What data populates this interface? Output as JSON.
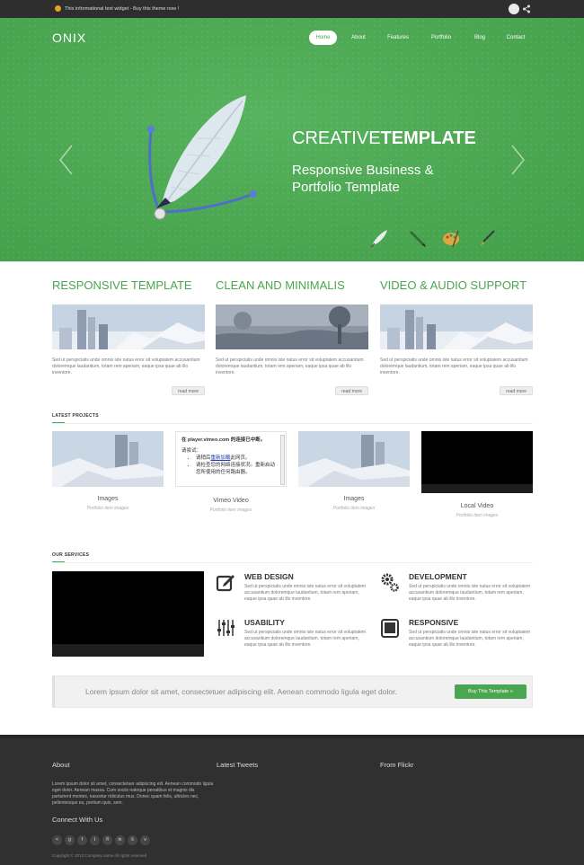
{
  "topbar": {
    "info_text": "This informational text widget - Buy this theme now !"
  },
  "header": {
    "logo": "ONIX",
    "nav": [
      {
        "label": "Home",
        "active": true
      },
      {
        "label": "About",
        "active": false
      },
      {
        "label": "Features",
        "active": false
      },
      {
        "label": "Portfolio",
        "active": false
      },
      {
        "label": "Blog",
        "active": false
      },
      {
        "label": "Contact",
        "active": false
      }
    ]
  },
  "hero": {
    "title_light": "CREATIVE",
    "title_bold": "TEMPLATE",
    "subtitle": "Responsive Business & Portfolio Template",
    "tools": [
      "feather-tool-icon",
      "pen-tool-icon",
      "palette-tool-icon",
      "brush-tool-icon"
    ]
  },
  "features": [
    {
      "title": "RESPONSIVE TEMPLATE",
      "text": "Sed ut perspiciatis unde omnis iste natus error sit voluptatem accusantium doloremque laudantium, totam rem aperiam, eaque ipsa quae ab illo inventore.",
      "button": "read more",
      "image": "city-skyline"
    },
    {
      "title": "CLEAN AND MINIMALIS",
      "text": "Sed ut perspiciatis unde omnis iste natus error sit voluptatem accusantium doloremque laudantium, totam rem aperiam, eaque ipsa quae ab illo inventore.",
      "button": "read more",
      "image": "tree-landscape"
    },
    {
      "title": "VIDEO & AUDIO SUPPORT",
      "text": "Sed ut perspiciatis unde omnis iste natus error sit voluptatem accusantium doloremque laudantium, totam rem aperiam, eaque ipsa quae ab illo inventore.",
      "button": "read more",
      "image": "city-skyline"
    }
  ],
  "latest_projects": {
    "label": "LATEST PROJECTS",
    "items": [
      {
        "title": "Images",
        "subtitle": "Portfolio item images"
      },
      {
        "title": "Vimeo Video",
        "subtitle": "Portfolio item images"
      },
      {
        "title": "Images",
        "subtitle": "Portfolio item images"
      },
      {
        "title": "Local Video",
        "subtitle": "Portfolio item images"
      }
    ],
    "vimeo": {
      "line1": "在 player.vimeo.com 的连接已中断。",
      "line2": "请尝试：",
      "bullet1_prefix": "请稍后",
      "bullet1_link": "重新加载",
      "bullet1_suffix": "此网页。",
      "bullet2": "请检查您的网络连接状况。重新启动您所使用的任何路由器。"
    }
  },
  "services": {
    "label": "OUR SERVICES",
    "items": [
      {
        "title": "WEB DESIGN",
        "icon": "pencil-edit-icon",
        "text": "Sed ut perspiciatis unde omnis iste natus error sit voluptatem accusantium doloremque laudantium, totam rem aperiam, eaque ipsa quae ab illo inventore."
      },
      {
        "title": "DEVELOPMENT",
        "icon": "gears-icon",
        "text": "Sed ut perspiciatis unde omnis iste natus error sit voluptatem accusantium doloremque laudantium, totam rem aperiam, eaque ipsa quae ab illo inventore."
      },
      {
        "title": "USABILITY",
        "icon": "sliders-icon",
        "text": "Sed ut perspiciatis unde omnis iste natus error sit voluptatem accusantium doloremque laudantium, totam rem aperiam, eaque ipsa quae ab illo inventore."
      },
      {
        "title": "RESPONSIVE",
        "icon": "tablet-icon",
        "text": "Sed ut perspiciatis unde omnis iste natus error sit voluptatem accusantium doloremque laudantium, totam rem aperiam, eaque ipsa quae ab illo inventore."
      }
    ]
  },
  "cta": {
    "text": "Lorem ipsum dolor sit amet, consectetuer adipiscing elit. Aenean commodo ligula eget dolor.",
    "button": "Buy This Template »"
  },
  "footer": {
    "about_title": "About",
    "about_text": "Lorem ipsum dolor sit amet, consectetuer adipiscing elit. Aenean commodo ligula eget dolor. Aenean massa. Cum sociis natoque penatibus et magnis dis parturient montes, nascetur ridiculus mus. Donec quam felis, ultricies nec, pellentesque eu, pretium quis, sem.",
    "tweets_title": "Latest Tweets",
    "flickr_title": "From Flickr",
    "connect_title": "Connect With Us",
    "socials": [
      "<",
      "g",
      "f",
      "t",
      "fl",
      "in",
      "li",
      "v"
    ],
    "copyright": "Copyright © 2013 Company name All rights reserved"
  },
  "colors": {
    "accent": "#4aa650",
    "topbar": "#2e2e2e",
    "footer": "#303030"
  }
}
